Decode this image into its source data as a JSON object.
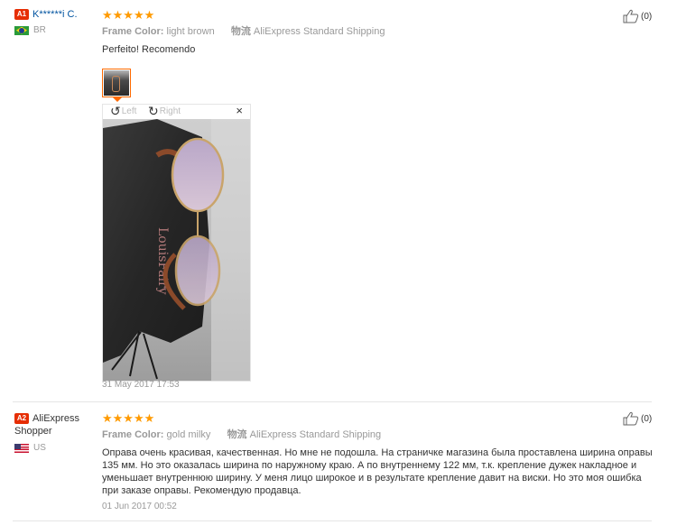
{
  "reviews": [
    {
      "level": "A1",
      "user": "K******i C.",
      "country": "BR",
      "rating": "★★★★★",
      "attr1_key": "Frame Color:",
      "attr1_val": "light brown",
      "attr2_key": "物流",
      "attr2_val": "AliExpress Standard Shipping",
      "text": "Perfeito! Recomendo",
      "viewer_left": "Left",
      "viewer_right": "Right",
      "close": "×",
      "date": "31 May 2017 17:53",
      "helpful": "(0)"
    },
    {
      "level": "A2",
      "user": "AliExpress Shopper",
      "country": "US",
      "rating": "★★★★★",
      "attr1_key": "Frame Color:",
      "attr1_val": "gold milky",
      "attr2_key": "物流",
      "attr2_val": "AliExpress Standard Shipping",
      "text": "Оправа очень красивая, качественная. Но мне не подошла. На страничке магазина была проставлена ширина оправы 135 мм. Но это оказалась ширина по наружному краю. А по внутреннему 122 мм, т.к. крепление дужек накладное и уменьшает внутреннюю ширину. У меня лицо широкое и в результате крепление давит на виски. Но это моя ошибка при заказе оправы. Рекомендую продавца.",
      "date": "01 Jun 2017 00:52",
      "helpful": "(0)"
    }
  ],
  "colors": {
    "star": "#ff9a00",
    "badge": "#e62e04",
    "link": "#0053a0",
    "thumb_border": "#ff6a00"
  },
  "icons": {
    "thumb": "thumbs-up-icon",
    "rotate_left": "rotate-left-icon",
    "rotate_right": "rotate-right-icon",
    "close": "close-icon"
  }
}
